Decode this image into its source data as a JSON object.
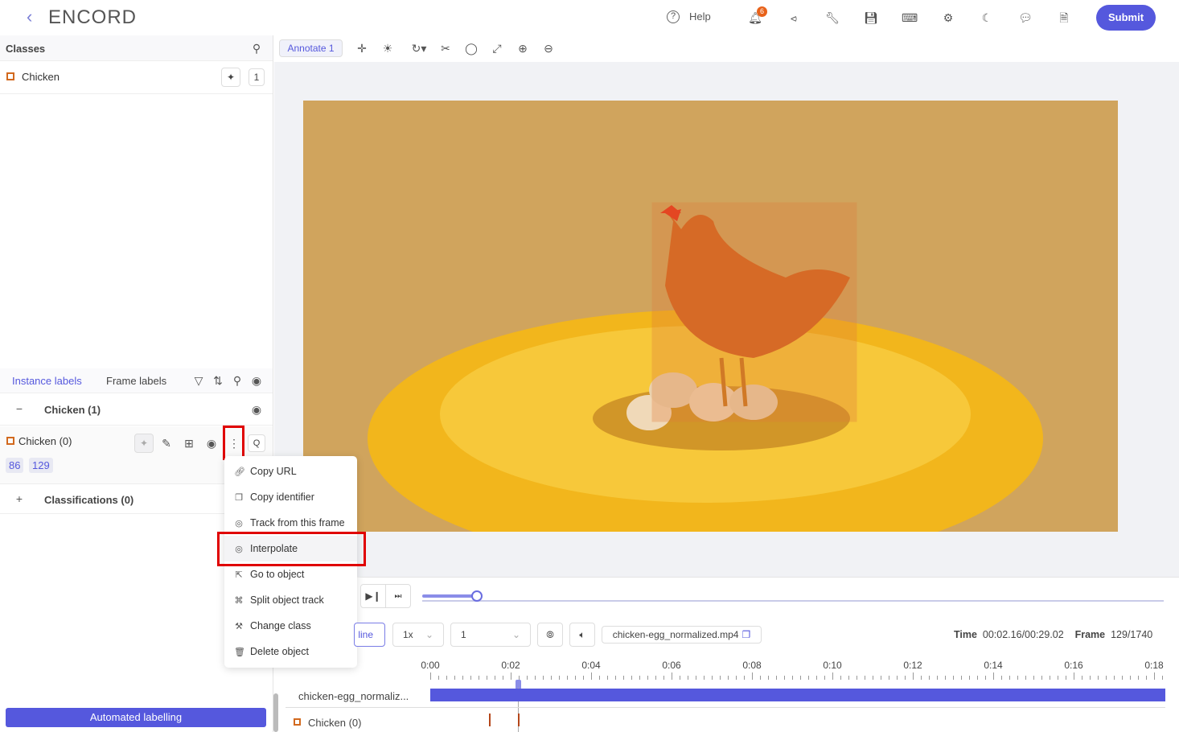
{
  "header": {
    "logo": "ENCORD",
    "help": "Help",
    "notification_count": "6",
    "submit": "Submit",
    "icons": [
      "question-icon",
      "bell-icon",
      "share-icon",
      "wrench-icon",
      "save-icon",
      "keyboard-icon",
      "gear-icon",
      "moon-icon",
      "chat-icon",
      "document-icon"
    ]
  },
  "classes": {
    "title": "Classes",
    "items": [
      {
        "label": "Chicken",
        "count": "1"
      }
    ]
  },
  "toolbar": {
    "mode": "Annotate 1"
  },
  "labels": {
    "tabs": [
      "Instance labels",
      "Frame labels"
    ],
    "active_tab": "Instance labels",
    "group": "Chicken (1)",
    "instance": {
      "label": "Chicken (0)",
      "frames": [
        "86",
        "129"
      ],
      "hotkey": "Q"
    },
    "classifications": "Classifications (0)"
  },
  "context_menu": {
    "items": [
      "Copy URL",
      "Copy identifier",
      "Track from this frame",
      "Interpolate",
      "Go to object",
      "Split object track",
      "Change class",
      "Delete object"
    ],
    "highlighted": "Interpolate"
  },
  "automated_labelling": "Automated labelling",
  "player": {
    "mode_button": "line",
    "speed": "1x",
    "step": "1",
    "filename": "chicken-egg_normalized.mp4",
    "time_label": "Time",
    "time": "00:02.16/00:29.02",
    "frame_label": "Frame",
    "frame": "129/1740",
    "progress_percent": 7.4
  },
  "timeline": {
    "ticks": [
      "0:00",
      "0:02",
      "0:04",
      "0:06",
      "0:08",
      "0:10",
      "0:12",
      "0:14",
      "0:16",
      "0:18"
    ],
    "video_track": "chicken-egg_normaliz...",
    "object_track": "Chicken (0)"
  },
  "colors": {
    "accent": "#5558dd",
    "highlight": "#e00000",
    "class_color": "#d2691e",
    "notification": "#e8621a"
  }
}
